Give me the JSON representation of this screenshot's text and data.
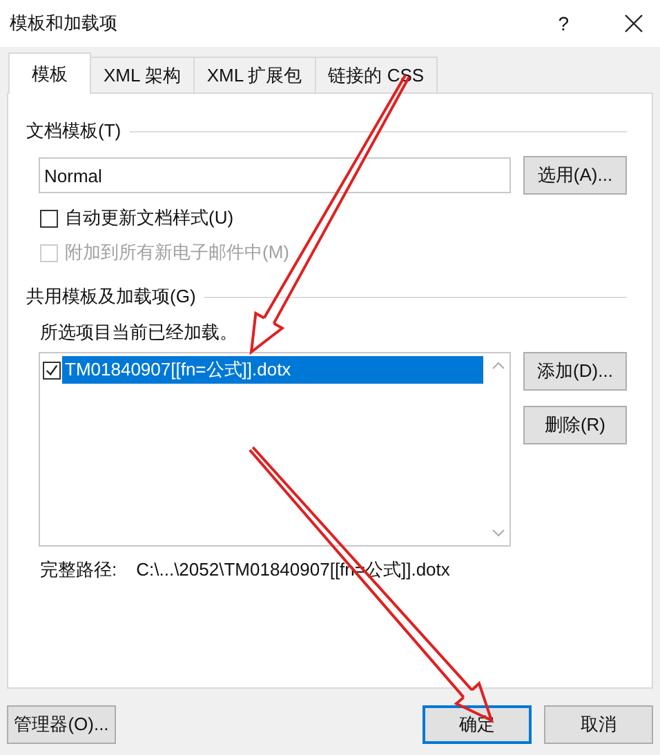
{
  "window": {
    "title": "模板和加载项",
    "help": "?"
  },
  "tabs": [
    {
      "label": "模板",
      "selected": true
    },
    {
      "label": "XML 架构",
      "selected": false
    },
    {
      "label": "XML 扩展包",
      "selected": false
    },
    {
      "label": "链接的 CSS",
      "selected": false
    }
  ],
  "document_template": {
    "legend": "文档模板(T)",
    "value": "Normal",
    "button": "选用(A)...",
    "options": [
      {
        "label": "自动更新文档样式(U)",
        "checked": false,
        "disabled": false
      },
      {
        "label": "附加到所有新电子邮件中(M)",
        "checked": false,
        "disabled": true
      }
    ]
  },
  "global_templates": {
    "legend": "共用模板及加载项(G)",
    "note": "所选项目当前已经加载。",
    "items": [
      {
        "label": "TM01840907[[fn=公式]].dotx",
        "checked": true,
        "selected": true
      }
    ],
    "buttons": [
      "添加(D)...",
      "删除(R)"
    ],
    "path_label": "完整路径:",
    "path": "C:\\...\\2052\\TM01840907[[fn=公式]].dotx"
  },
  "footer": {
    "organizer": "管理器(O)...",
    "ok": "确定",
    "cancel": "取消"
  },
  "annotations": [
    {
      "kind": "arrow"
    },
    {
      "kind": "arrow"
    }
  ]
}
